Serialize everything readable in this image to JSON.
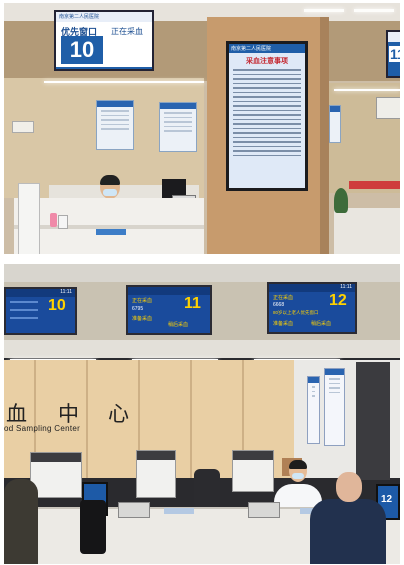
{
  "top_photo": {
    "left_sign": {
      "header": "南京第二人民医院",
      "window_label": "优先窗口",
      "status": "正在采血",
      "number": "10"
    },
    "center_poster": {
      "title": "采血注意事项",
      "header": "南京第二人民医院"
    },
    "right_sign": {
      "number": "11"
    }
  },
  "bottom_photo": {
    "displays": [
      {
        "time": "11:11",
        "number": "10",
        "number_color": "#ffd200"
      },
      {
        "label_now": "正在采血",
        "detail": "6795",
        "label_wait": "准备采血",
        "label_next": "稍后采血",
        "number": "11",
        "number_color": "#ffd200"
      },
      {
        "time": "11:11",
        "label_now": "正在采血",
        "detail": "6668",
        "extra": "80岁以上老人优先窗口",
        "label_wait": "准备采血",
        "label_next": "稍后采血",
        "number": "12",
        "number_color": "#ffd200"
      }
    ],
    "wall_text": {
      "glyph_1": "血",
      "glyph_2": "中",
      "glyph_3": "心",
      "caption": "od Sampling Center"
    },
    "kiosk_screen_number": "12"
  }
}
